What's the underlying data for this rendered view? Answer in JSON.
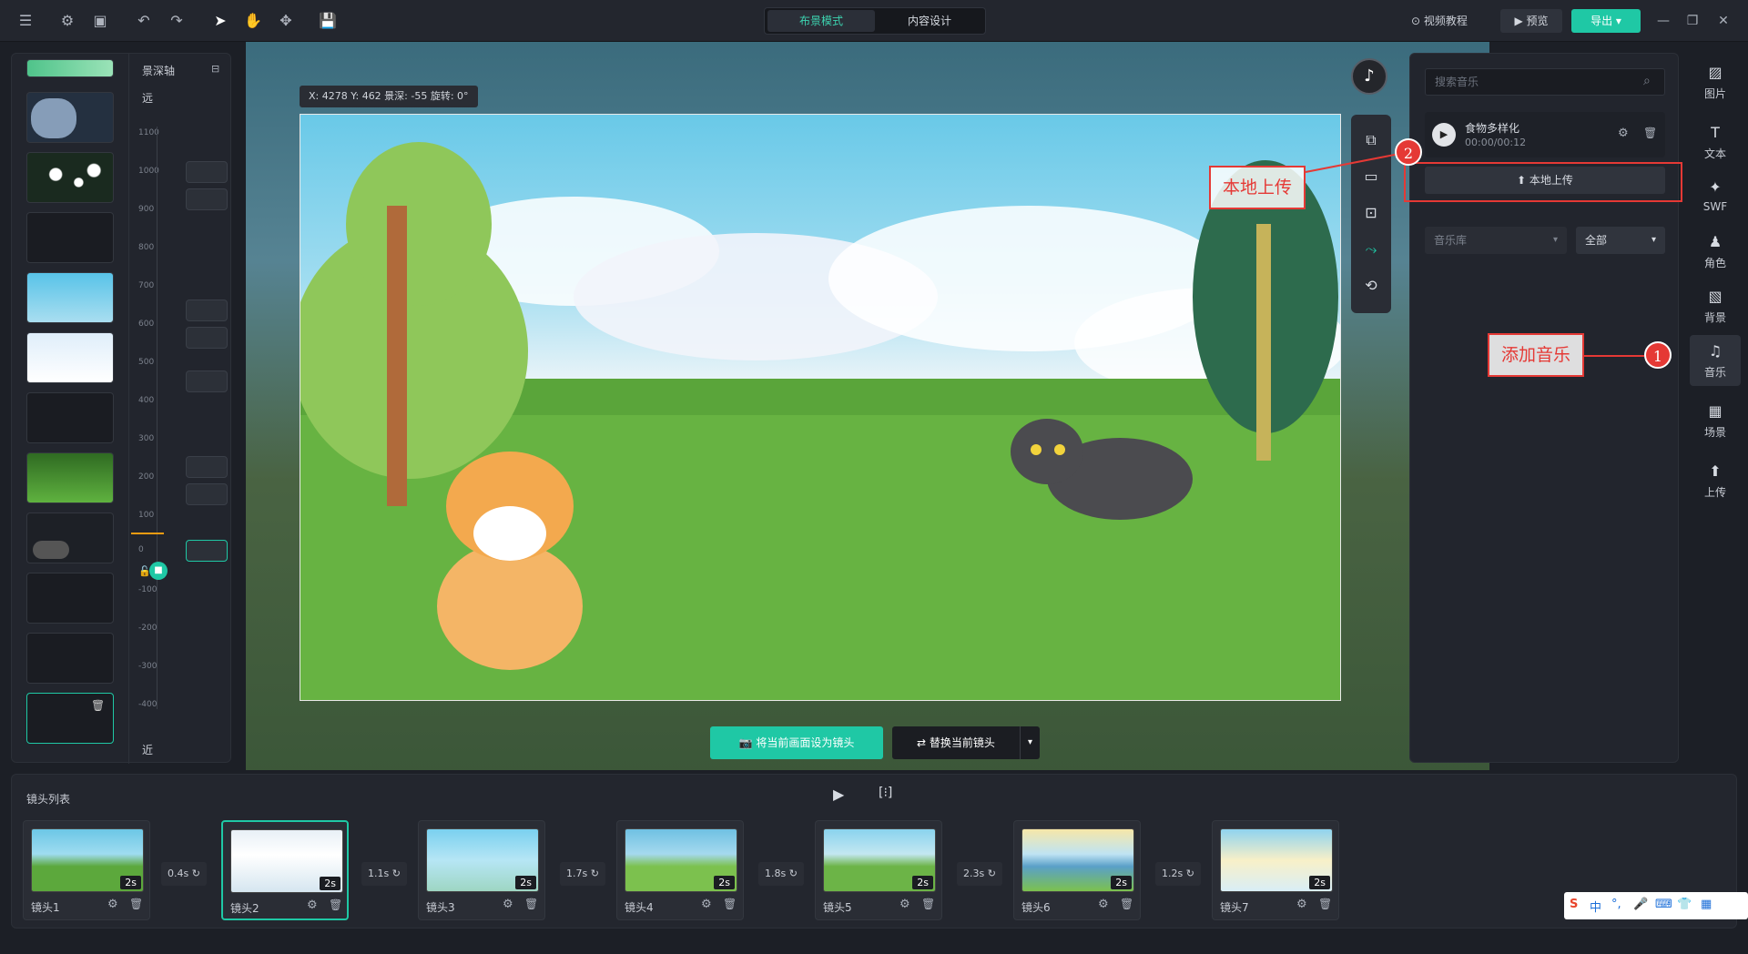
{
  "toolbar": {
    "mode_layout": "布景模式",
    "mode_content": "内容设计",
    "tutorial": "视频教程",
    "preview": "预览",
    "export": "导出"
  },
  "depth_axis": {
    "title": "景深轴",
    "far": "远",
    "near": "近",
    "ticks": [
      "1100",
      "1000",
      "900",
      "800",
      "700",
      "600",
      "500",
      "400",
      "300",
      "200",
      "100",
      "0",
      "-100",
      "-200",
      "-300",
      "-400"
    ]
  },
  "canvas": {
    "coords": "X: 4278   Y: 462   景深: -55   旋转: 0°",
    "set_shot": "将当前画面设为镜头",
    "replace_shot": "替换当前镜头"
  },
  "music_panel": {
    "search_placeholder": "搜索音乐",
    "track_name": "食物多样化",
    "track_time": "00:00/00:12",
    "upload": "本地上传",
    "library": "音乐库",
    "category": "全部"
  },
  "side_nav": [
    {
      "label": "图片",
      "icon": "image-icon"
    },
    {
      "label": "文本",
      "icon": "text-icon"
    },
    {
      "label": "SWF",
      "icon": "swf-icon"
    },
    {
      "label": "角色",
      "icon": "character-icon"
    },
    {
      "label": "背景",
      "icon": "background-icon"
    },
    {
      "label": "音乐",
      "icon": "music-icon"
    },
    {
      "label": "场景",
      "icon": "scene-icon"
    },
    {
      "label": "上传",
      "icon": "upload-icon"
    }
  ],
  "annotations": {
    "label1": "添加音乐",
    "num1": "1",
    "label2": "本地上传",
    "num2": "2"
  },
  "shots": {
    "title": "镜头列表",
    "items": [
      {
        "name": "镜头1",
        "duration": "2s"
      },
      {
        "name": "镜头2",
        "duration": "2s"
      },
      {
        "name": "镜头3",
        "duration": "2s"
      },
      {
        "name": "镜头4",
        "duration": "2s"
      },
      {
        "name": "镜头5",
        "duration": "2s"
      },
      {
        "name": "镜头6",
        "duration": "2s"
      },
      {
        "name": "镜头7",
        "duration": "2s"
      }
    ],
    "transitions": [
      "0.4s",
      "1.1s",
      "1.7s",
      "1.8s",
      "2.3s",
      "1.2s"
    ]
  },
  "ime": {
    "lang": "中"
  }
}
